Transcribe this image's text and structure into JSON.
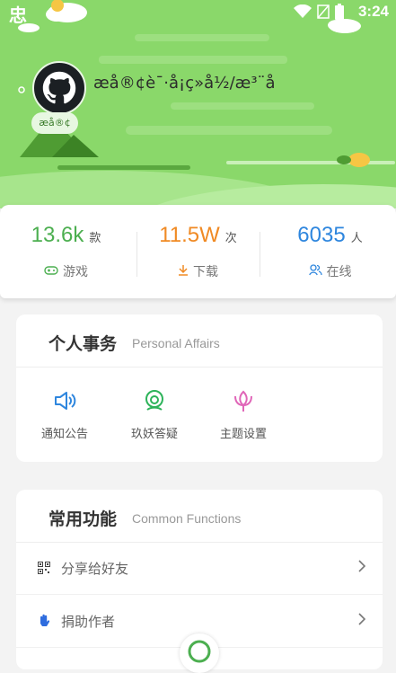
{
  "status_bar": {
    "carrier": "忠",
    "time": "3:24"
  },
  "profile": {
    "name": "æå®¢è¯·å¡ç»å½/æ³¨å",
    "badge": "æå®¢"
  },
  "stats": [
    {
      "value": "13.6k",
      "unit": "款",
      "label": "游戏",
      "color": "#4caf50",
      "icon": "gamepad-icon"
    },
    {
      "value": "11.5W",
      "unit": "次",
      "label": "下载",
      "color": "#f08a24",
      "icon": "download-icon"
    },
    {
      "value": "6035",
      "unit": "人",
      "label": "在线",
      "color": "#2e86de",
      "icon": "users-icon"
    }
  ],
  "personal": {
    "title": "个人事务",
    "subtitle": "Personal Affairs",
    "items": [
      {
        "label": "通知公告",
        "icon": "megaphone-icon",
        "color": "#2e86de"
      },
      {
        "label": "玖妖答疑",
        "icon": "support-icon",
        "color": "#2db35a"
      },
      {
        "label": "主题设置",
        "icon": "lotus-icon",
        "color": "#e066b8"
      }
    ]
  },
  "common": {
    "title": "常用功能",
    "subtitle": "Common Functions",
    "items": [
      {
        "label": "分享给好友",
        "icon": "qr-code-icon"
      },
      {
        "label": "捐助作者",
        "icon": "donate-hand-icon"
      }
    ]
  }
}
